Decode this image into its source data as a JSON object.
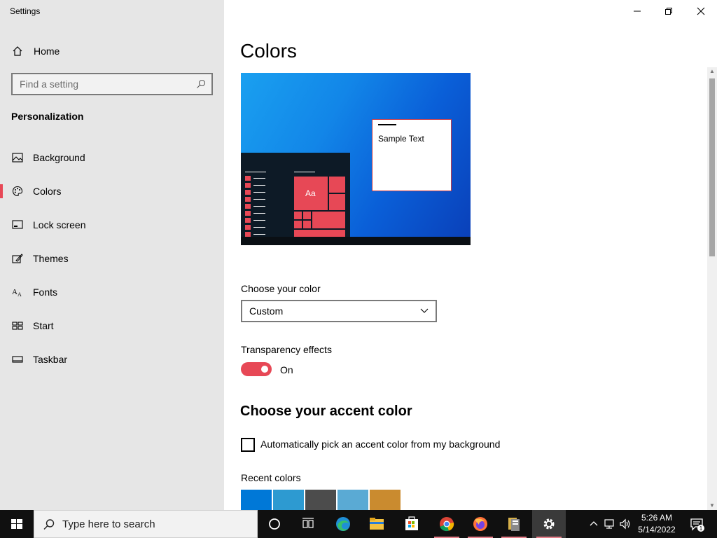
{
  "window": {
    "title": "Settings",
    "controls": [
      "minimize",
      "restore",
      "close"
    ]
  },
  "sidebar": {
    "home_label": "Home",
    "search_placeholder": "Find a setting",
    "section_title": "Personalization",
    "items": [
      {
        "label": "Background",
        "icon": "image-icon",
        "selected": false
      },
      {
        "label": "Colors",
        "icon": "palette-icon",
        "selected": true
      },
      {
        "label": "Lock screen",
        "icon": "lock-screen-icon",
        "selected": false
      },
      {
        "label": "Themes",
        "icon": "themes-icon",
        "selected": false
      },
      {
        "label": "Fonts",
        "icon": "fonts-icon",
        "selected": false
      },
      {
        "label": "Start",
        "icon": "start-icon",
        "selected": false
      },
      {
        "label": "Taskbar",
        "icon": "taskbar-icon",
        "selected": false
      }
    ]
  },
  "main": {
    "title": "Colors",
    "preview": {
      "sample_text": "Sample Text",
      "tile_text": "Aa"
    },
    "choose_color_label": "Choose your color",
    "choose_color_value": "Custom",
    "transparency_label": "Transparency effects",
    "transparency_state": "On",
    "accent_heading": "Choose your accent color",
    "auto_accent_label": "Automatically pick an accent color from my background",
    "auto_accent_checked": false,
    "recent_colors_label": "Recent colors",
    "recent_colors": [
      "#0078d7",
      "#2d9ad1",
      "#4c4c4c",
      "#5aaad4",
      "#ca8b2f"
    ]
  },
  "colors": {
    "accent": "#e74856",
    "sidebar_bg": "#e6e6e6",
    "taskbar_bg": "#101010"
  },
  "taskbar": {
    "search_placeholder": "Type here to search",
    "apps": [
      "cortana-icon",
      "task-view-icon",
      "edge-icon",
      "file-explorer-icon",
      "store-icon",
      "chrome-icon",
      "firefox-icon",
      "archive-icon",
      "settings-icon"
    ],
    "clock_time": "5:26 AM",
    "clock_date": "5/14/2022",
    "notification_count": "1"
  }
}
